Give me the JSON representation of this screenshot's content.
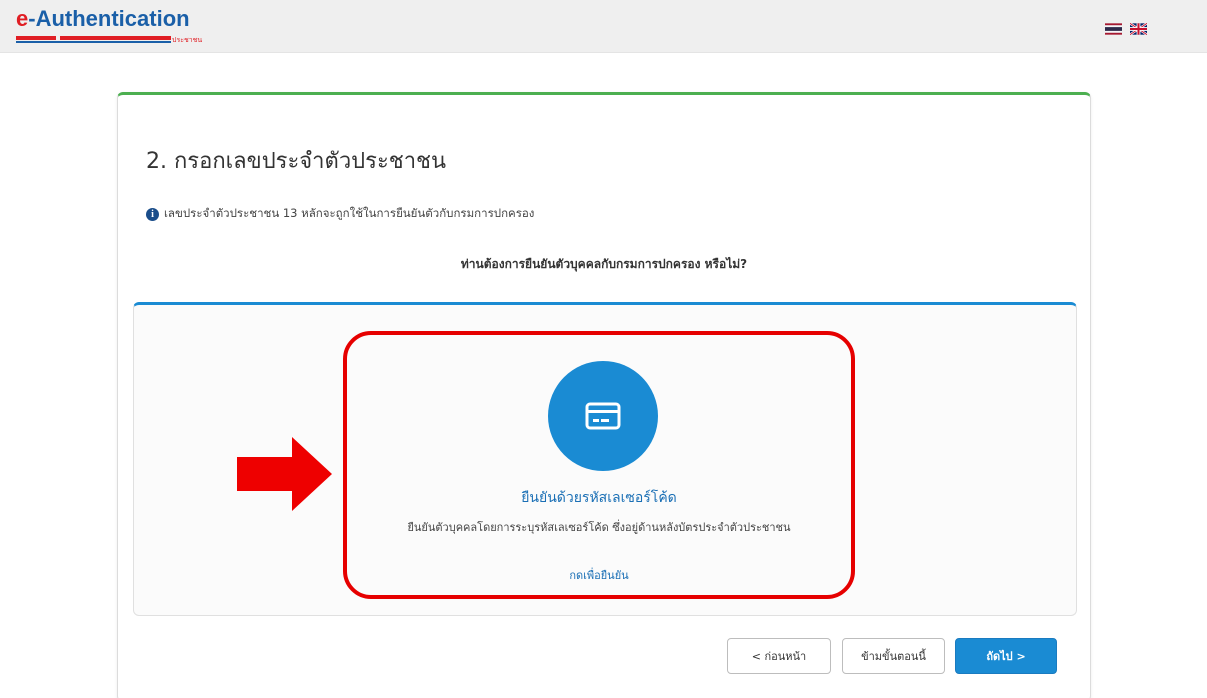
{
  "header": {
    "logo_prefix": "e",
    "logo_main": "-Authentication",
    "logo_sub": "ประชาชน",
    "languages": [
      "th",
      "en"
    ]
  },
  "main": {
    "step_title": "2. กรอกเลขประจำตัวประชาชน",
    "info_text": "เลขประจำตัวประชาชน 13 หลักจะถูกใช้ในการยืนยันตัวกับกรมการปกครอง",
    "question": "ท่านต้องการยืนยันตัวบุคคลกับกรมการปกครอง หรือไม่?",
    "option": {
      "icon": "credit-card-icon",
      "title": "ยืนยันด้วยรหัสเลเซอร์โค้ด",
      "description": "ยืนยันตัวบุคคลโดยการระบุรหัสเลเซอร์โค้ด ซึ่งอยู่ด้านหลังบัตรประจำตัวประชาชน",
      "link": "กดเพื่อยืนยัน"
    }
  },
  "buttons": {
    "prev": "< ก่อนหน้า",
    "skip": "ข้ามขั้นตอนนี้",
    "next": "ถัดไป >"
  },
  "colors": {
    "accent": "#1a8bd3",
    "card_top": "#4caf50",
    "highlight": "#e60000",
    "logo_blue": "#1a5fa8",
    "logo_red": "#e01e24"
  }
}
